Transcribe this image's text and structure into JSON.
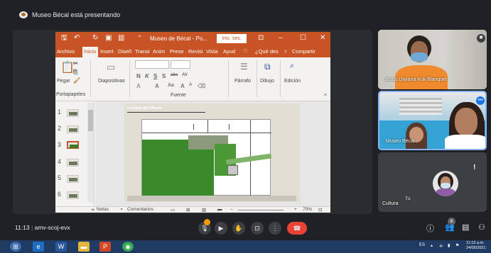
{
  "meet": {
    "banner": "Museo Bécal está presentando",
    "meeting_time": "11:13",
    "meeting_code": "amv-scoj-evx",
    "people_count": "6"
  },
  "ppt": {
    "doc_title": "Museo de Bécal - Po...",
    "signin": "Inic. ses.",
    "tabs": [
      "Archivo",
      "Inicio",
      "Insert",
      "Diseñ",
      "Transi",
      "Anim",
      "Prese",
      "Revisi",
      "Vista",
      "Ayud"
    ],
    "tell_me": "¿Qué des",
    "share": "Compartir",
    "ribbon": {
      "paste": "Pegar",
      "slides": "Diapositivas",
      "font_group": "Fuente",
      "paragraph": "Párrafo",
      "drawing": "Dibujo",
      "editing": "Edición",
      "clipboard": "Portapapeles"
    },
    "thumbnails": [
      "1",
      "2",
      "3",
      "4",
      "5",
      "6"
    ],
    "slide_title": "Croquis del Museo",
    "status": {
      "notes": "Notas",
      "comments": "Comentarios",
      "zoom": "70%"
    }
  },
  "participants": {
    "p1": "Jesus Dayana Kuk Blanquet",
    "p2": "Museo Bécal",
    "self": "Tú",
    "self_sub": "Cultura"
  },
  "taskbar": {
    "lang": "ES",
    "time": "11:13 a.m.",
    "date": "24/05/2021"
  },
  "colors": {
    "ppt_accent": "#c85425",
    "meet_bg": "#202124",
    "end_call": "#ea4335",
    "active_speaker": "#8ab4f8"
  }
}
